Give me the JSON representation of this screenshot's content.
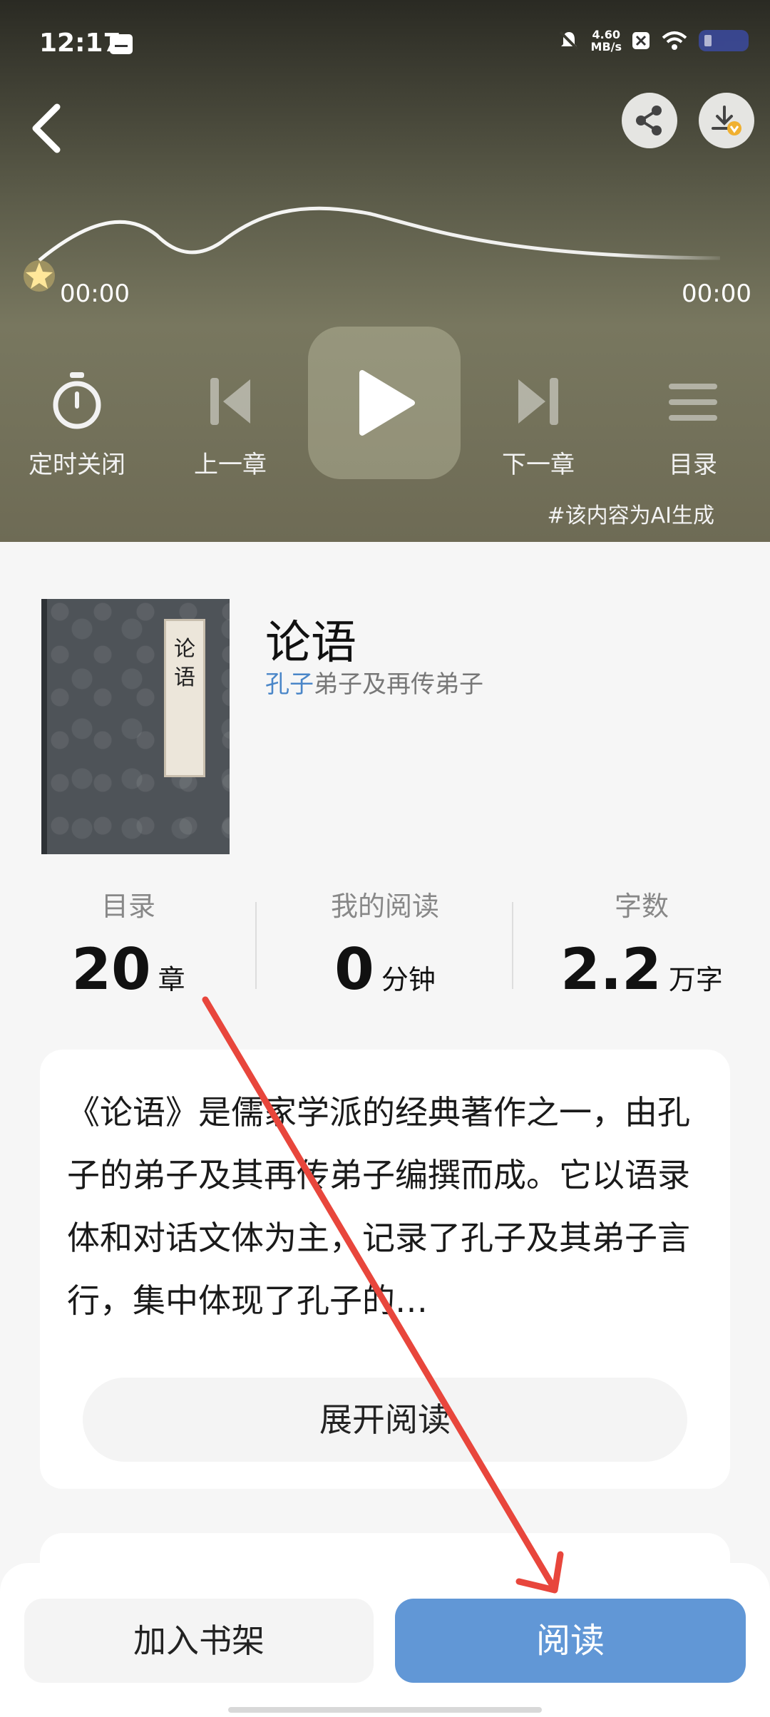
{
  "status_bar": {
    "time": "12:17",
    "net_speed_value": "4.60",
    "net_speed_unit": "MB/s"
  },
  "player": {
    "current_time": "00:00",
    "total_time": "00:00",
    "controls": {
      "timer_label": "定时关闭",
      "prev_label": "上一章",
      "next_label": "下一章",
      "toc_label": "目录"
    },
    "ai_note": "#该内容为AI生成"
  },
  "book": {
    "cover_text": "论语",
    "title": "论语",
    "author_link": "孔子",
    "author_rest": "弟子及再传弟子"
  },
  "stats": [
    {
      "heading": "目录",
      "value": "20",
      "unit": "章"
    },
    {
      "heading": "我的阅读",
      "value": "0",
      "unit": "分钟"
    },
    {
      "heading": "字数",
      "value": "2.2",
      "unit": "万字"
    }
  ],
  "intro": {
    "text": "《论语》是儒家学派的经典著作之一，由孔子的弟子及其再传弟子编撰而成。它以语录体和对话文体为主，记录了孔子及其弟子言行，集中体现了孔子的…",
    "expand_label": "展开阅读"
  },
  "bottom_bar": {
    "shelf_label": "加入书架",
    "read_label": "阅读"
  },
  "colors": {
    "accent": "#6197d6",
    "author_link": "#4a86c8",
    "annotation_arrow": "#e8463c"
  }
}
